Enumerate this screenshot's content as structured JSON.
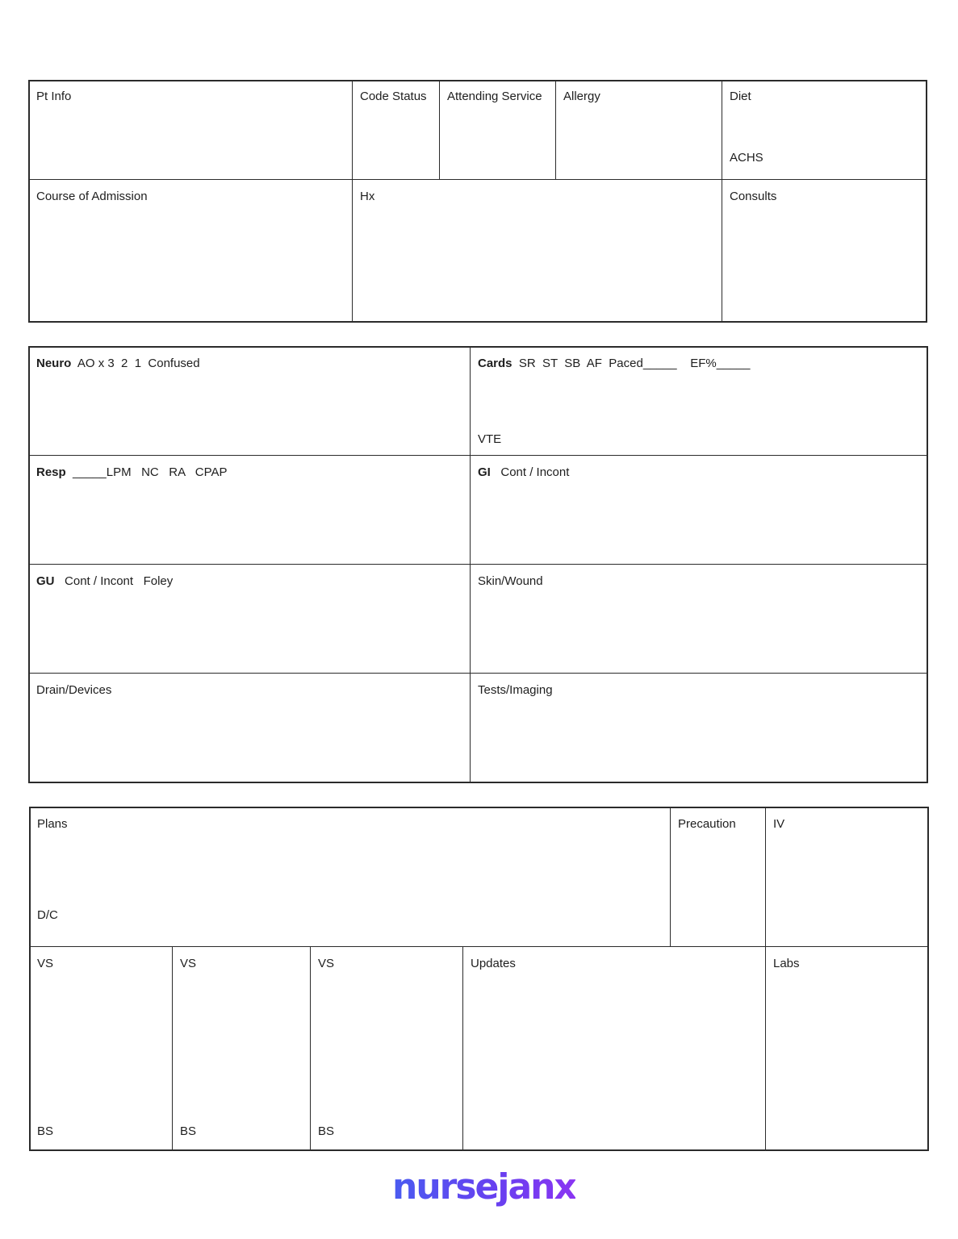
{
  "section1": {
    "pt_info": "Pt Info",
    "code_status": "Code Status",
    "attending_service": "Attending Service",
    "allergy": "Allergy",
    "diet": "Diet",
    "achs": "ACHS",
    "course_of_admission": "Course of Admission",
    "hx": "Hx",
    "consults": "Consults"
  },
  "section2": {
    "neuro": {
      "label": "Neuro",
      "options": "AO x 3  2  1  Confused"
    },
    "cards": {
      "label": "Cards",
      "options": "SR  ST  SB  AF  Paced_____    EF%_____"
    },
    "vte": "VTE",
    "resp": {
      "label": "Resp",
      "options": "_____LPM   NC   RA   CPAP"
    },
    "gi": {
      "label": "GI",
      "options": "Cont / Incont"
    },
    "gu": {
      "label": "GU",
      "options": "Cont / Incont   Foley"
    },
    "skin_wound": "Skin/Wound",
    "drain_devices": "Drain/Devices",
    "tests_imaging": "Tests/Imaging"
  },
  "section3": {
    "plans": "Plans",
    "dc": "D/C",
    "precaution": "Precaution",
    "iv": "IV",
    "vs": [
      "VS",
      "VS",
      "VS"
    ],
    "bs": [
      "BS",
      "BS",
      "BS"
    ],
    "updates": "Updates",
    "labs": "Labs"
  },
  "footer": {
    "logo": "nursejanx",
    "logo_color": "#5b48f0"
  }
}
